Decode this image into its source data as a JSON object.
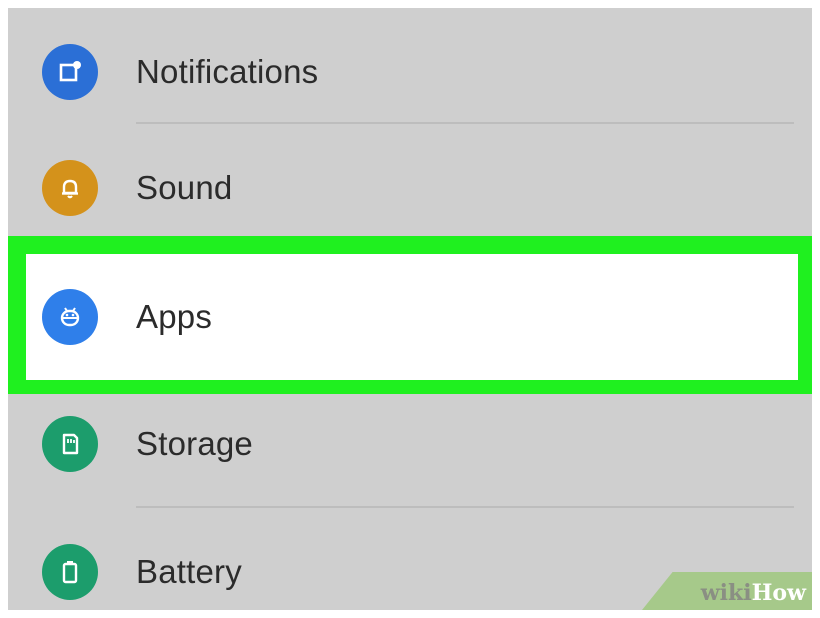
{
  "settings_list": {
    "items": [
      {
        "label": "Notifications",
        "icon": "notifications-icon",
        "color": "#2b6fd6"
      },
      {
        "label": "Sound",
        "icon": "bell-icon",
        "color": "#d4921b"
      },
      {
        "label": "Apps",
        "icon": "android-icon",
        "color": "#2f7fea"
      },
      {
        "label": "Storage",
        "icon": "sd-card-icon",
        "color": "#1c9d6c"
      },
      {
        "label": "Battery",
        "icon": "battery-icon",
        "color": "#1c9d6c"
      }
    ]
  },
  "highlight": {
    "color": "#1ff01f",
    "item": "Apps"
  },
  "watermark": {
    "part1": "wiki",
    "part2": "How"
  }
}
